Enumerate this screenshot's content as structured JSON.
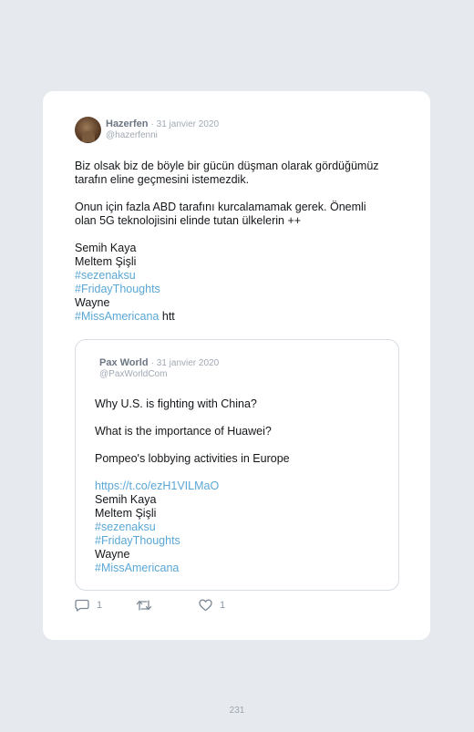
{
  "tweet": {
    "author_name": "Hazerfen",
    "date": "· 31 janvier 2020",
    "handle": "@hazerfenni",
    "paragraphs": [
      [
        "Biz olsak biz de böyle bir gücün düşman olarak gördüğümüz",
        "tarafın eline geçmesini istemezdik."
      ],
      [
        "Onun için fazla ABD tarafını kurcalamamak gerek. Önemli",
        "olan 5G teknolojisini elinde tutan ülkelerin ++"
      ]
    ],
    "lines": {
      "name1": "Semih Kaya",
      "name2": "Meltem Şişli",
      "tag1": "#sezenaksu",
      "tag2": "#FridayThoughts",
      "name3": "Wayne",
      "tag3": "#MissAmericana",
      "trail": " htt"
    }
  },
  "quote": {
    "author_name": "Pax World",
    "date": "· 31 janvier 2020",
    "handle": "@PaxWorldCom",
    "p1": "Why U.S. is fighting with China?",
    "p2": "What is the importance of Huawei?",
    "p3": "Pompeo's lobbying activities in Europe",
    "link": "https://t.co/ezH1VILMaO",
    "name1": "Semih Kaya",
    "name2": "Meltem Şişli",
    "tag1": "#sezenaksu",
    "tag2": "#FridayThoughts",
    "name3": "Wayne",
    "tag3": "#MissAmericana"
  },
  "actions": {
    "reply_icon": "reply-icon",
    "reply_count": "1",
    "retweet_icon": "retweet-icon",
    "like_icon": "heart-icon",
    "like_count": "1"
  },
  "colors": {
    "hashtag": "#5aa7d6",
    "background": "#e6eaee"
  },
  "page_number": "231"
}
